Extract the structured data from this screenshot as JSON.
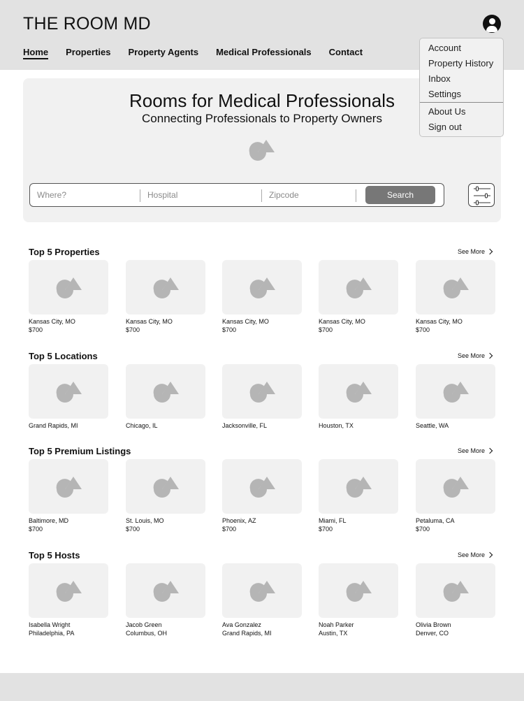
{
  "header": {
    "logo": "THE ROOM MD",
    "nav": [
      "Home",
      "Properties",
      "Property Agents",
      "Medical Professionals",
      "Contact"
    ]
  },
  "account_menu": {
    "items": [
      "Account",
      "Property History",
      "Inbox",
      "Settings"
    ],
    "secondary_items": [
      "About Us",
      "Sign out"
    ]
  },
  "hero": {
    "title": "Rooms for Medical Professionals",
    "subtitle": "Connecting Professionals to Property Owners",
    "search": {
      "where_placeholder": "Where?",
      "hospital_placeholder": "Hospital",
      "zipcode_placeholder": "Zipcode",
      "button": "Search"
    }
  },
  "sections": [
    {
      "title": "Top 5 Properties",
      "see_more": "See More",
      "items": [
        {
          "line1": "Kansas City, MO",
          "line2": "$700"
        },
        {
          "line1": "Kansas City, MO",
          "line2": "$700"
        },
        {
          "line1": "Kansas City, MO",
          "line2": "$700"
        },
        {
          "line1": "Kansas City, MO",
          "line2": "$700"
        },
        {
          "line1": "Kansas City, MO",
          "line2": "$700"
        }
      ]
    },
    {
      "title": "Top 5 Locations",
      "see_more": "See More",
      "items": [
        {
          "line1": "Grand Rapids, MI"
        },
        {
          "line1": "Chicago, IL"
        },
        {
          "line1": "Jacksonville, FL"
        },
        {
          "line1": "Houston, TX"
        },
        {
          "line1": "Seattle, WA"
        }
      ]
    },
    {
      "title": "Top 5 Premium Listings",
      "see_more": "See More",
      "items": [
        {
          "line1": "Baltimore, MD",
          "line2": "$700"
        },
        {
          "line1": "St. Louis, MO",
          "line2": "$700"
        },
        {
          "line1": "Phoenix, AZ",
          "line2": "$700"
        },
        {
          "line1": "Miami, FL",
          "line2": "$700"
        },
        {
          "line1": "Petaluma, CA",
          "line2": "$700"
        }
      ]
    },
    {
      "title": "Top 5 Hosts",
      "see_more": "See More",
      "items": [
        {
          "line1": "Isabella Wright",
          "line2": "Philadelphia, PA"
        },
        {
          "line1": "Jacob Green",
          "line2": "Columbus, OH"
        },
        {
          "line1": "Ava Gonzalez",
          "line2": "Grand Rapids, MI"
        },
        {
          "line1": "Noah Parker",
          "line2": "Austin, TX"
        },
        {
          "line1": "Olivia Brown",
          "line2": "Denver, CO"
        }
      ]
    }
  ],
  "icons": {
    "placeholder": "image-placeholder-icon",
    "avatar": "user-avatar-icon",
    "filter": "sliders-icon",
    "chevron": "chevron-right-icon"
  },
  "colors": {
    "header_bg": "#e2e2e2",
    "panel_bg": "#f1f1f1",
    "placeholder_shape": "#b5b5b5",
    "button_bg": "#777777"
  }
}
